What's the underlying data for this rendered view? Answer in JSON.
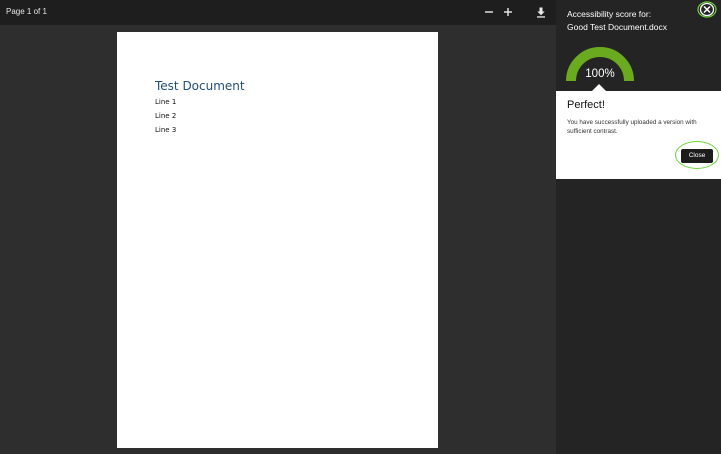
{
  "viewer": {
    "page_indicator": "Page 1 of 1",
    "zoom_out_icon": "minus-icon",
    "zoom_in_icon": "plus-icon",
    "download_icon": "download-icon"
  },
  "document": {
    "title": "Test Document",
    "lines": [
      "Line 1",
      "Line 2",
      "Line 3"
    ]
  },
  "panel": {
    "title_line1": "Accessibility score for:",
    "title_line2": "Good Test Document.docx",
    "score": "100%",
    "score_value": 1.0,
    "gauge_color": "#6aaa1e",
    "close_icon": "close-circle-icon",
    "result_heading": "Perfect!",
    "result_message": "You have successfully uploaded a version with sufficient contrast.",
    "close_button": "Close",
    "highlight_color": "#6bd43a"
  }
}
